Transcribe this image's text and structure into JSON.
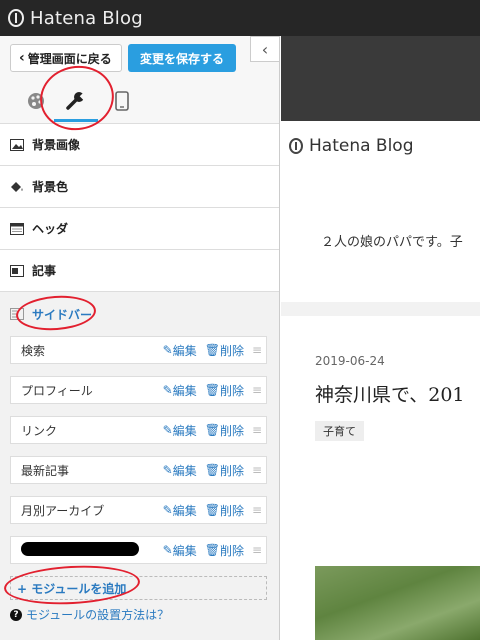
{
  "app": {
    "title": "Hatena Blog"
  },
  "panel": {
    "back_label": "管理画面に戻る",
    "save_label": "変更を保存する",
    "collapse_icon": "chevron-left-icon",
    "tabs": [
      {
        "name": "design",
        "icon": "palette-icon"
      },
      {
        "name": "customize",
        "icon": "wrench-icon",
        "active": true
      },
      {
        "name": "device",
        "icon": "smartphone-icon"
      }
    ],
    "sections": {
      "background_image": "背景画像",
      "background_color": "背景色",
      "header": "ヘッダ",
      "article": "記事",
      "sidebar": "サイドバー"
    },
    "modules": [
      {
        "name": "検索",
        "edit": "編集",
        "delete": "削除"
      },
      {
        "name": "プロフィール",
        "edit": "編集",
        "delete": "削除"
      },
      {
        "name": "リンク",
        "edit": "編集",
        "delete": "削除"
      },
      {
        "name": "最新記事",
        "edit": "編集",
        "delete": "削除"
      },
      {
        "name": "月別アーカイブ",
        "edit": "編集",
        "delete": "削除"
      },
      {
        "name": "",
        "edit": "編集",
        "delete": "削除"
      }
    ],
    "add_module": "+ モジュールを追加",
    "help_link": "モジュールの設置方法は？"
  },
  "preview": {
    "brand": "Hatena Blog",
    "description": "２人の娘のパパです。子",
    "date": "2019-06-24",
    "title": "神奈川県で、201",
    "tag": "子育て"
  },
  "colors": {
    "accent": "#2a9ee0",
    "link": "#2a7ac0",
    "annotation": "#e2202f"
  }
}
